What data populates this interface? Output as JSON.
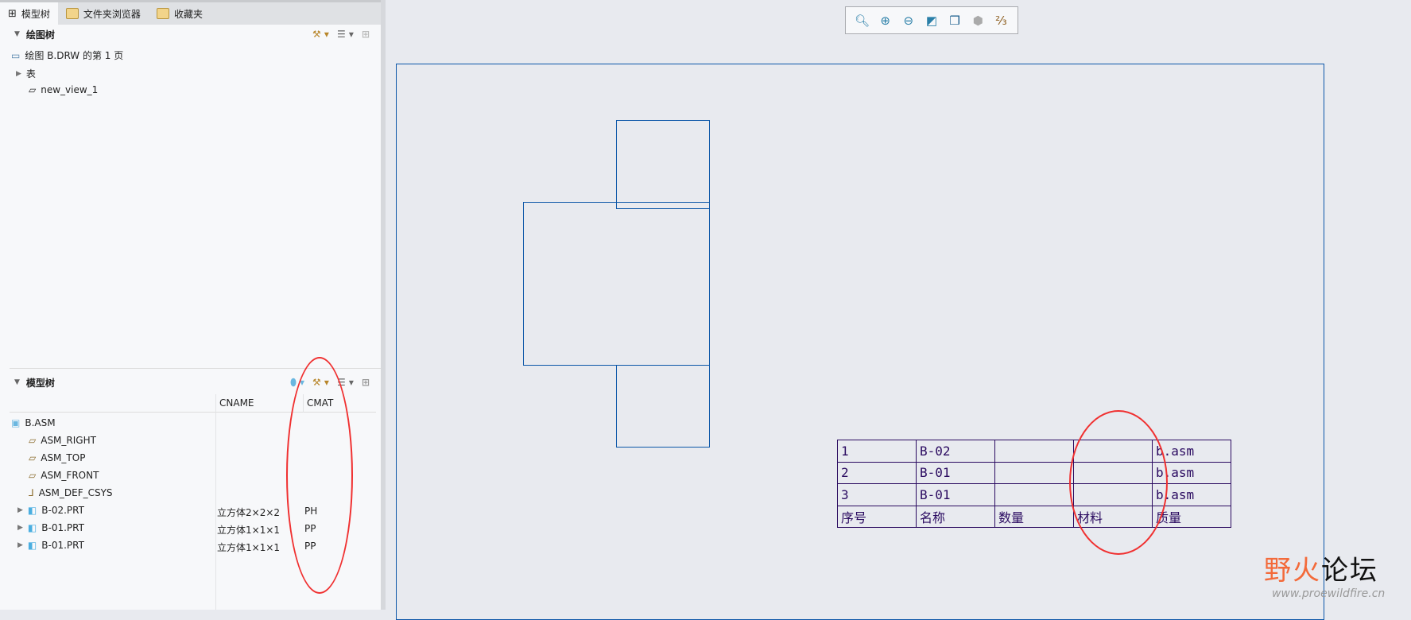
{
  "tabs": [
    {
      "label": "模型树",
      "icon": "model-tree-icon"
    },
    {
      "label": "文件夹浏览器",
      "icon": "folder-icon"
    },
    {
      "label": "收藏夹",
      "icon": "favorites-icon"
    }
  ],
  "drawing_tree": {
    "title": "绘图树",
    "items": [
      {
        "label": "绘图 B.DRW 的第 1 页",
        "icon": "drawing-sheet-icon"
      },
      {
        "label": "表",
        "icon": "expand-icon"
      },
      {
        "label": "new_view_1",
        "icon": "view-icon"
      }
    ]
  },
  "model_tree": {
    "title": "模型树",
    "columns": [
      "CNAME",
      "CMAT"
    ],
    "rows": [
      {
        "name": "B.ASM",
        "cname": "",
        "cmat": "",
        "icon": "assembly-icon"
      },
      {
        "name": "ASM_RIGHT",
        "cname": "",
        "cmat": "",
        "icon": "datum-plane-icon"
      },
      {
        "name": "ASM_TOP",
        "cname": "",
        "cmat": "",
        "icon": "datum-plane-icon"
      },
      {
        "name": "ASM_FRONT",
        "cname": "",
        "cmat": "",
        "icon": "datum-plane-icon"
      },
      {
        "name": "ASM_DEF_CSYS",
        "cname": "",
        "cmat": "",
        "icon": "csys-icon"
      },
      {
        "name": "B-02.PRT",
        "cname": "立方体2×2×2",
        "cmat": "PH",
        "icon": "part-icon"
      },
      {
        "name": "B-01.PRT",
        "cname": "立方体1×1×1",
        "cmat": "PP",
        "icon": "part-icon"
      },
      {
        "name": "B-01.PRT",
        "cname": "立方体1×1×1",
        "cmat": "PP",
        "icon": "part-icon"
      }
    ]
  },
  "toolbar": [
    "refit-icon",
    "zoom-in-icon",
    "zoom-out-icon",
    "repaint-icon",
    "display-style-icon",
    "saved-views-icon",
    "datum-display-icon"
  ],
  "bom": {
    "rows": [
      [
        "1",
        "B-02",
        "",
        "",
        "b.asm"
      ],
      [
        "2",
        "B-01",
        "",
        "",
        "b.asm"
      ],
      [
        "3",
        "B-01",
        "",
        "",
        "b.asm"
      ]
    ],
    "header": [
      "序号",
      "名称",
      "数量",
      "材料",
      "质量"
    ]
  },
  "watermark": {
    "brand": "野火论坛",
    "url": "www.proewildfire.cn"
  },
  "colors": {
    "line": "#0b56a8",
    "table": "#2a0a60",
    "annotation": "#f03030"
  }
}
